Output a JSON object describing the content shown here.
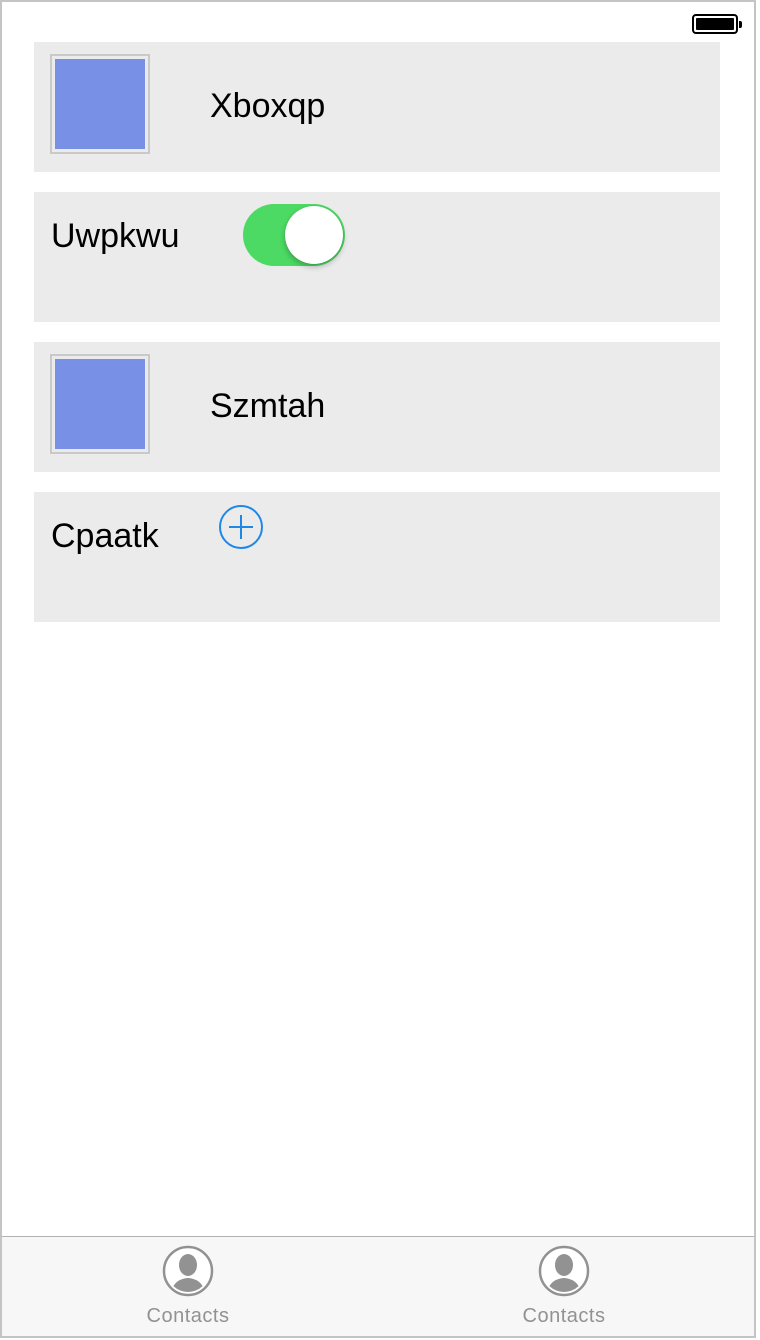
{
  "colors": {
    "cell_background": "#ebebeb",
    "thumbnail": "#7890e6",
    "toggle_on": "#4cd964",
    "add_button": "#1e88e5",
    "tab_inactive": "#929292"
  },
  "status_bar": {
    "battery_icon": "battery-full-icon"
  },
  "cells": [
    {
      "type": "image-label",
      "label": "Xboxqp"
    },
    {
      "type": "switch",
      "label": "Uwpkwu",
      "switch_on": true
    },
    {
      "type": "image-label",
      "label": "Szmtah"
    },
    {
      "type": "add",
      "label": "Cpaatk",
      "icon": "plus-circle-icon"
    }
  ],
  "tabbar": {
    "tabs": [
      {
        "label": "Contacts",
        "icon": "contacts-icon"
      },
      {
        "label": "Contacts",
        "icon": "contacts-icon"
      }
    ]
  }
}
